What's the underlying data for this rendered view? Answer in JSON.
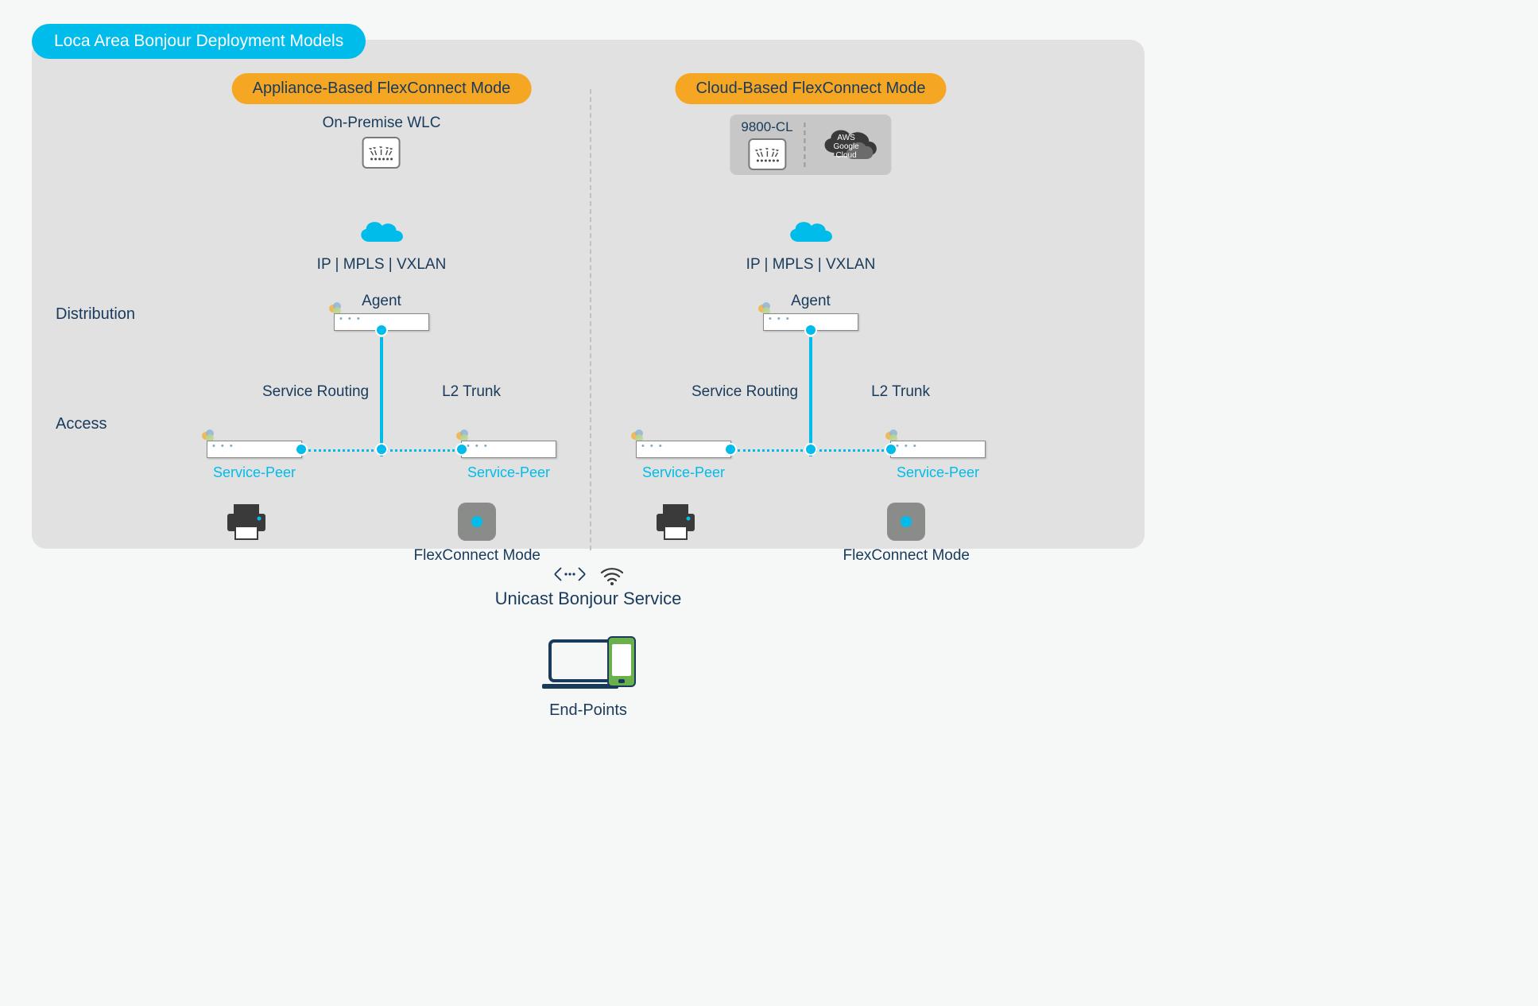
{
  "title": "Loca Area Bonjour Deployment Models",
  "rows": {
    "distribution": "Distribution",
    "access": "Access"
  },
  "left": {
    "mode": "Appliance-Based FlexConnect Mode",
    "wlc": "On-Premise WLC",
    "network": "IP | MPLS | VXLAN",
    "agent": "Agent",
    "serviceRouting": "Service Routing",
    "l2trunk": "L2 Trunk",
    "servicePeer": "Service-Peer",
    "flexLabel": "FlexConnect Mode"
  },
  "right": {
    "mode": "Cloud-Based FlexConnect Mode",
    "cloudWlc": "9800-CL",
    "cloudProviders": "AWS\nGoogle\nCloud",
    "network": "IP | MPLS | VXLAN",
    "agent": "Agent",
    "serviceRouting": "Service Routing",
    "l2trunk": "L2 Trunk",
    "servicePeer": "Service-Peer",
    "flexLabel": "FlexConnect Mode"
  },
  "bottom": {
    "unicast": "Unicast Bonjour Service",
    "endpoints": "End-Points"
  }
}
